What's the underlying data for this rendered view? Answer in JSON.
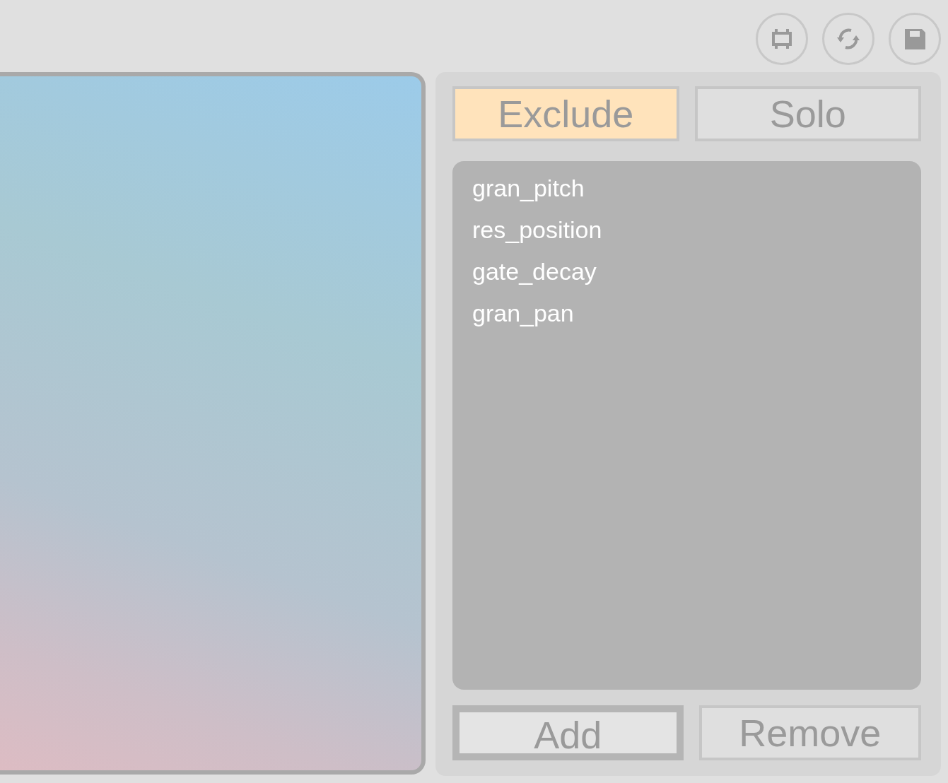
{
  "toolbar": [
    {
      "kind": "bracket"
    },
    {
      "kind": "refresh"
    },
    {
      "kind": "save"
    }
  ],
  "mode_tabs": [
    {
      "label": "Exclude",
      "selected": true
    },
    {
      "label": "Solo",
      "selected": false
    }
  ],
  "parameters": [
    "gran_pitch",
    "res_position",
    "gate_decay",
    "gran_pan"
  ],
  "buttons": [
    {
      "label": "Add",
      "focused": true
    },
    {
      "label": "Remove",
      "focused": false
    }
  ]
}
